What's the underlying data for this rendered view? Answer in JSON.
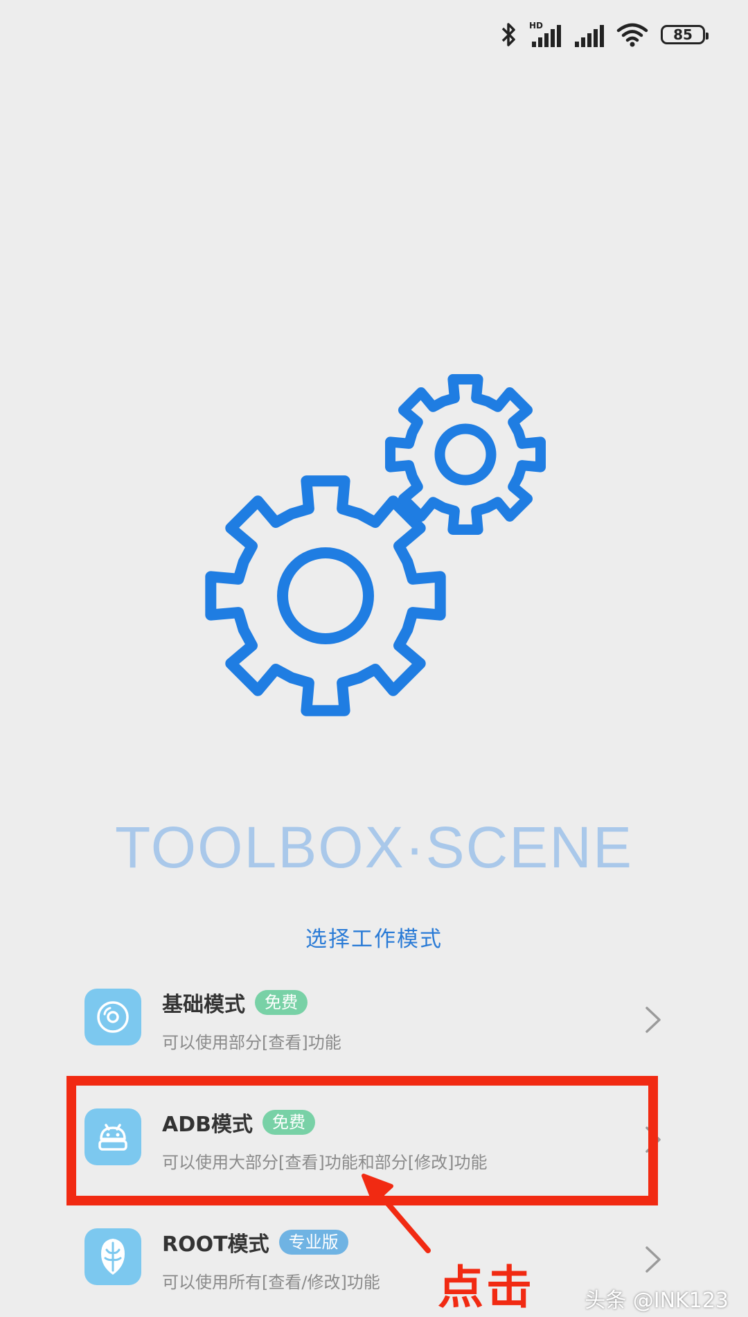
{
  "status_bar": {
    "network_label": "HD",
    "battery_level": "85",
    "icons": [
      "bluetooth-icon",
      "signal-hd-icon",
      "signal-icon",
      "wifi-icon",
      "battery-icon"
    ]
  },
  "app": {
    "brand_title": "TOOLBOX·SCENE",
    "subtitle": "选择工作模式",
    "accent_color": "#2a7bd6"
  },
  "modes": [
    {
      "title": "基础模式",
      "badge": "免费",
      "badge_color": "#78d1a6",
      "description": "可以使用部分[查看]功能",
      "icon": "disc-icon"
    },
    {
      "title": "ADB模式",
      "badge": "免费",
      "badge_color": "#78d1a6",
      "description": "可以使用大部分[查看]功能和部分[修改]功能",
      "icon": "android-icon"
    },
    {
      "title": "ROOT模式",
      "badge": "专业版",
      "badge_color": "#6fb3e3",
      "description": "可以使用所有[查看/修改]功能",
      "icon": "root-mask-icon"
    }
  ],
  "annotation": {
    "click_label": "点击",
    "highlight_color": "#f12a12"
  },
  "watermark": "头条 @INK123"
}
